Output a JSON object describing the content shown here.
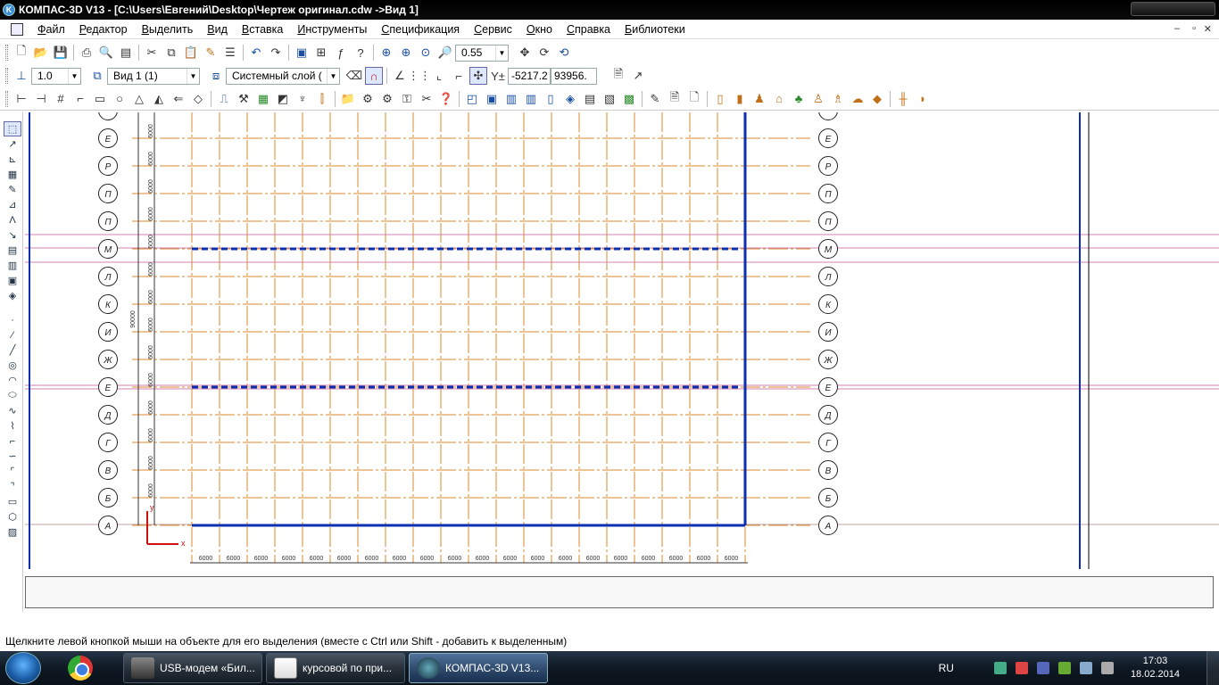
{
  "window": {
    "title": "КОМПАС-3D V13 - [C:\\Users\\Евгений\\Desktop\\Чертеж оригинал.cdw ->Вид 1]",
    "restore": "▫",
    "close": "✕",
    "minimize": "–"
  },
  "menu": {
    "items": [
      "Файл",
      "Редактор",
      "Выделить",
      "Вид",
      "Вставка",
      "Инструменты",
      "Спецификация",
      "Сервис",
      "Окно",
      "Справка",
      "Библиотеки"
    ]
  },
  "toolbar1": {
    "zoom_value": "0.55"
  },
  "toolbar2": {
    "scale_value": "1.0",
    "view_value": "Вид 1 (1)",
    "layer_value": "Системный слой (",
    "coord_x": "-5217.2",
    "coord_y": "93956.",
    "coord_label": "Y±"
  },
  "drawing": {
    "row_axis_labels": [
      "М",
      "Л",
      "К",
      "И",
      "Ж",
      "Е",
      "Д",
      "Г",
      "В",
      "Б",
      "А"
    ],
    "row_axis_labels_top": [
      "",
      "Е",
      "Р",
      "П",
      "П"
    ],
    "column_dimension_label": "6000",
    "total_dimension_label": "90000",
    "axis_x_label": "x",
    "axis_y_label": "y"
  },
  "status": {
    "hint": "Щелкните левой кнопкой мыши на объекте для его выделения (вместе с Ctrl или Shift - добавить к выделенным)"
  },
  "taskbar": {
    "buttons": [
      "USB-модем «Бил...",
      "курсовой по при...",
      "КОМПАС-3D V13..."
    ],
    "lang": "RU",
    "time": "17:03",
    "date": "18.02.2014"
  }
}
